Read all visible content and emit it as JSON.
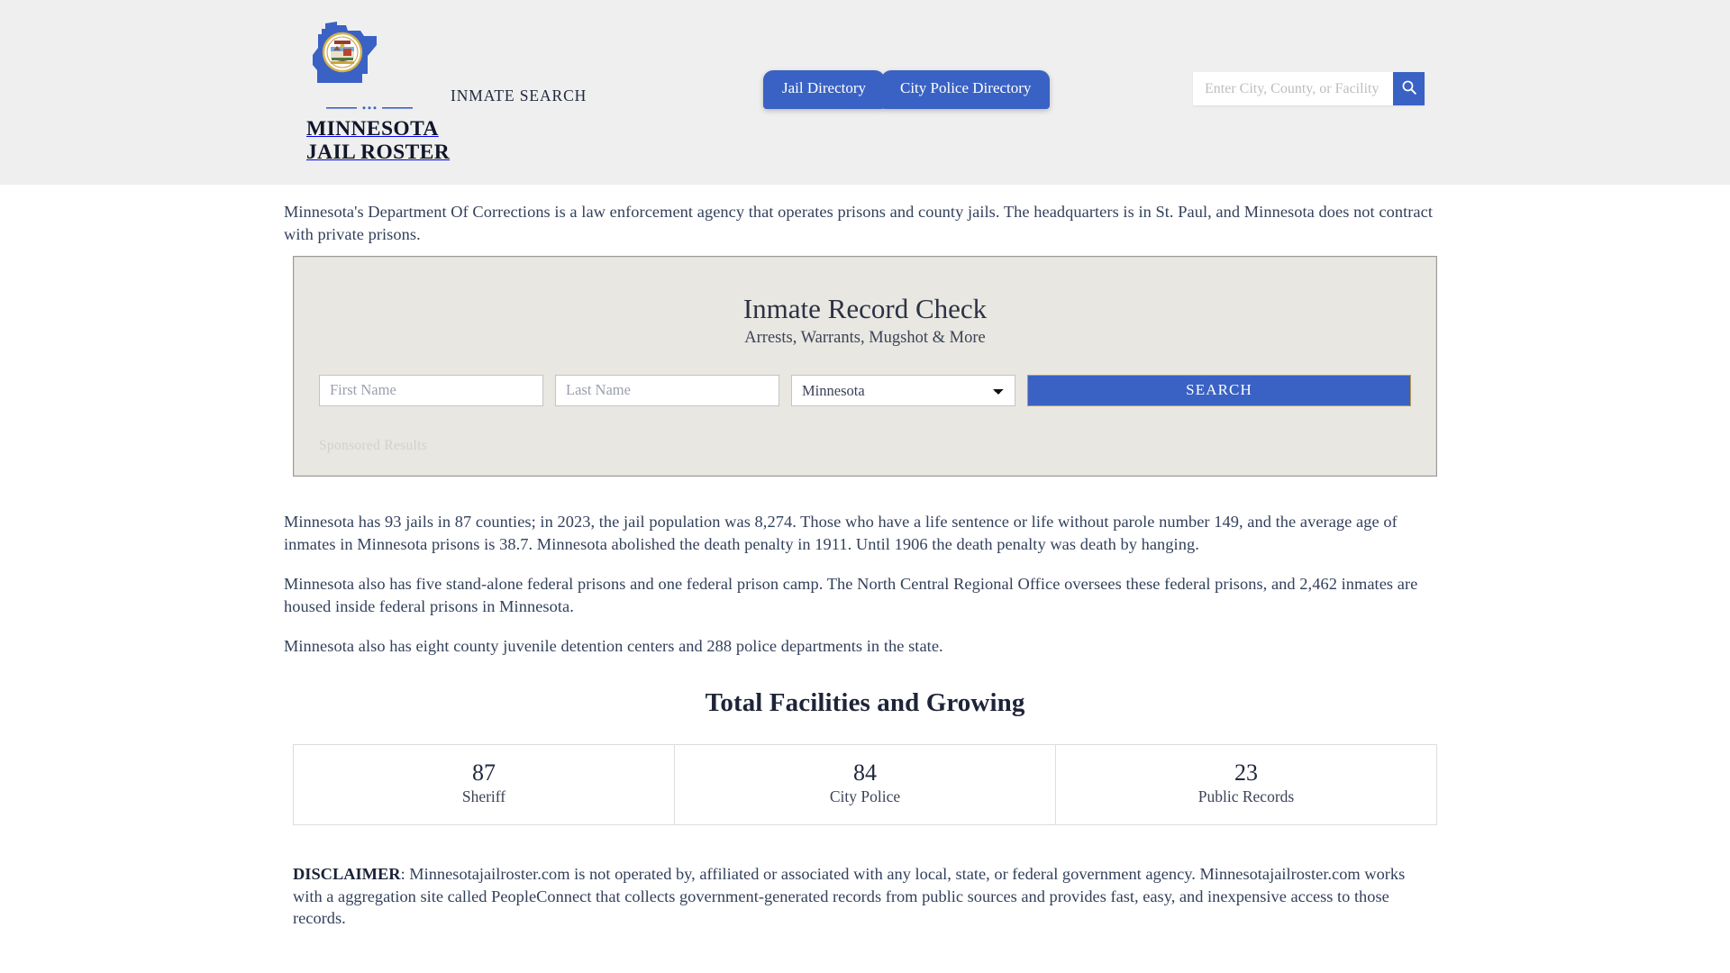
{
  "header": {
    "brand": {
      "line1": "MINNESOTA",
      "line2": "JAIL ROSTER",
      "logo_icon": "minnesota-state-seal-icon"
    },
    "tagline": "INMATE SEARCH",
    "nav": [
      {
        "label": "Jail Directory",
        "name": "jail-directory"
      },
      {
        "label": "City Police Directory",
        "name": "city-police-directory"
      }
    ],
    "search": {
      "placeholder": "Enter City, County, or Facility",
      "value": "",
      "button_icon": "search-icon"
    },
    "background_color": "#efefef",
    "accent_color": "#3a62c4"
  },
  "main": {
    "intro": "Minnesota's Department Of Corrections is a law enforcement agency that operates prisons and county jails. The headquarters is in St. Paul, and Minnesota does not contract with private prisons.",
    "record_card": {
      "title": "Inmate Record Check",
      "subtitle": "Arrests, Warrants, Mugshot & More",
      "first_name_placeholder": "First Name",
      "first_name_value": "",
      "last_name_placeholder": "Last Name",
      "last_name_value": "",
      "state_selected": "Minnesota",
      "state_options": [
        "Minnesota"
      ],
      "search_label": "SEARCH",
      "sponsored_label": "Sponsored Results",
      "background_color": "#e8e7e1",
      "button_color": "#3a62c4"
    },
    "paragraphs": [
      "Minnesota has 93 jails in 87 counties; in 2023, the jail population was 8,274. Those who have a life sentence or life without parole number 149, and the average age of inmates in Minnesota prisons is 38.7. Minnesota abolished the death penalty in 1911. Until 1906 the death penalty was death by hanging.",
      "Minnesota also has five stand-alone federal prisons and one federal prison camp. The North Central Regional Office oversees these federal prisons, and 2,462 inmates are housed inside federal prisons in Minnesota.",
      "Minnesota also has eight county juvenile detention centers and 288 police departments in the state."
    ],
    "stats": {
      "heading": "Total Facilities and Growing",
      "cells": [
        {
          "number": "87",
          "label": "Sheriff"
        },
        {
          "number": "84",
          "label": "City Police"
        },
        {
          "number": "23",
          "label": "Public Records"
        }
      ]
    },
    "disclaimer": {
      "prefix": "DISCLAIMER",
      "text": ": Minnesotajailroster.com is not operated by, affiliated or associated with any local, state, or federal government agency. Minnesotajailroster.com works with a aggregation site called PeopleConnect that collects government-generated records from public sources and provides fast, easy, and inexpensive access to those records."
    }
  }
}
